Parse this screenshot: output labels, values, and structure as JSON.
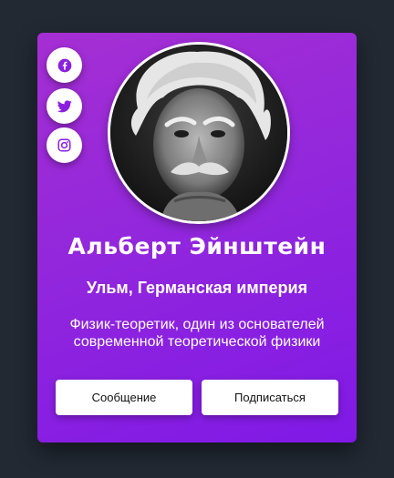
{
  "profile": {
    "name": "Альберт Эйнштейн",
    "location": "Ульм, Германская империя",
    "bio_line1": "Физик-теоретик, один из основателей",
    "bio_line2": "современной теоретической физики",
    "photo": "black-and-white portrait photo"
  },
  "social": [
    {
      "icon": "facebook-icon"
    },
    {
      "icon": "twitter-icon"
    },
    {
      "icon": "instagram-icon"
    }
  ],
  "actions": {
    "message_label": "Сообщение",
    "follow_label": "Подписаться"
  },
  "colors": {
    "page_background": "#222933",
    "card_gradient_start": "#a52fd3",
    "card_gradient_end": "#8019e6",
    "accent_icon": "#8a1fe0",
    "button_background": "#ffffff"
  }
}
